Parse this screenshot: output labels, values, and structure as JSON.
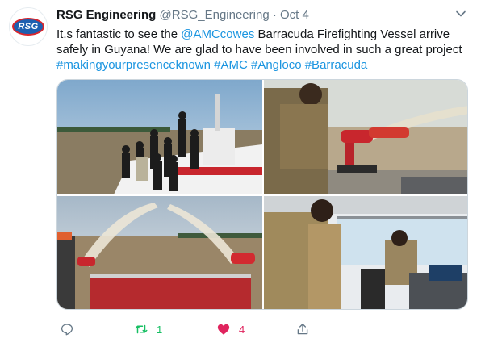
{
  "account": {
    "logo_text": "RSG",
    "name": "RSG Engineering",
    "handle": "@RSG_Engineering",
    "separator": "·",
    "date": "Oct 4"
  },
  "tweet": {
    "text_part1": "It.s fantastic to see the ",
    "mention": "@AMCcowes",
    "text_part2": " Barracuda Firefighting Vessel arrive safely in Guyana! We are glad to have been involved in such a great project ",
    "hashtags": [
      "#makingyourpresenceknown",
      "#AMC",
      "#Angloco",
      "#Barracuda"
    ]
  },
  "actions": {
    "reply_icon": "reply-icon",
    "retweet_icon": "retweet-icon",
    "retweet_count": "1",
    "like_icon": "heart-icon",
    "like_count": "4",
    "share_icon": "share-icon"
  },
  "colors": {
    "link": "#1b95e0",
    "retweet": "#17bf63",
    "like": "#e0245e",
    "muted": "#657786"
  }
}
